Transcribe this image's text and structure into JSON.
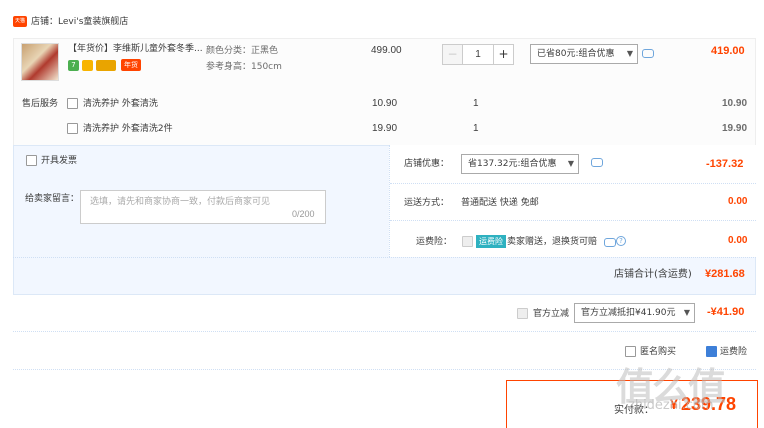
{
  "shop": {
    "badge": "天猫",
    "name": "店铺：Levi's童装旗舰店"
  },
  "item": {
    "title": "【年货价】李维斯儿童外套冬季...",
    "tags": {
      "seven": "7",
      "nianhuo": "年货"
    },
    "color": "颜色分类：正黑色",
    "size": "参考身高：150cm",
    "unit_price": "499.00",
    "qty_minus": "−",
    "qty": "1",
    "qty_plus": "+",
    "discount_select": "已省80元:组合优惠",
    "total": "419.00"
  },
  "aftersale": {
    "label": "售后服务",
    "services": [
      {
        "label": "清洗养护 外套清洗",
        "price": "10.90",
        "qty": "1",
        "total": "10.90"
      },
      {
        "label": "清洗养护 外套清洗2件",
        "price": "19.90",
        "qty": "1",
        "total": "19.90"
      }
    ]
  },
  "options": {
    "invoice_label": "开具发票",
    "message_label": "给卖家留言：",
    "message_placeholder": "选填，请先和商家协商一致，付款后商家可见",
    "message_count": "0/200",
    "shop_discount_label": "店铺优惠：",
    "shop_discount_select": "省137.32元:组合优惠",
    "shop_discount_amount": "-137.32",
    "delivery_label": "运送方式：",
    "delivery_value": "普通配送 快递 免邮",
    "delivery_amount": "0.00",
    "insure_label": "运费险：",
    "insure_badge": "运费险",
    "insure_text": "卖家赠送，退换货可赔",
    "insure_help": "?",
    "insure_amount": "0.00",
    "shop_total_label": "店铺合计(含运费)",
    "shop_total_amount": "¥281.68"
  },
  "official": {
    "label": "官方立减",
    "select": "官方立减抵扣¥41.90元",
    "amount": "-¥41.90"
  },
  "footer": {
    "anon_label": "匿名购买",
    "pay_label": "运费险",
    "pay_total_label": "实付款：",
    "pay_currency": "¥",
    "pay_total_amount": "239.78"
  },
  "watermark": {
    "logo": "值么值",
    "url": "zhidezhi.com"
  },
  "colors": {
    "accent": "#ff4400",
    "link": "#3d7fd8",
    "panel": "#f2f7ff"
  }
}
